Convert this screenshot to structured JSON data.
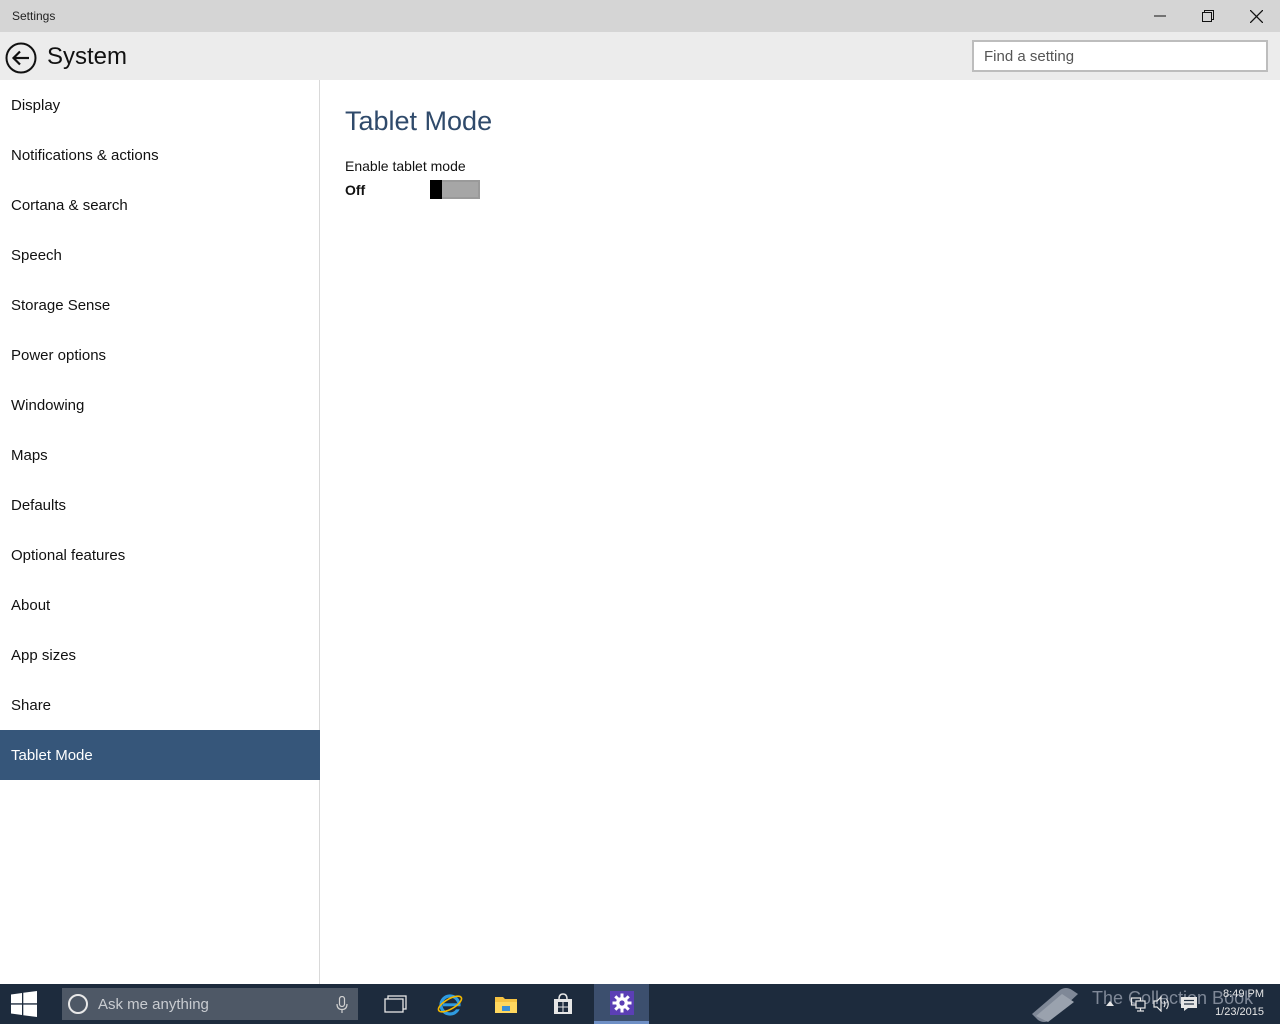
{
  "window": {
    "app_title": "Settings"
  },
  "header": {
    "title": "System",
    "search_placeholder": "Find a setting"
  },
  "sidebar": {
    "items": [
      {
        "label": "Display",
        "active": false
      },
      {
        "label": "Notifications & actions",
        "active": false
      },
      {
        "label": "Cortana & search",
        "active": false
      },
      {
        "label": "Speech",
        "active": false
      },
      {
        "label": "Storage Sense",
        "active": false
      },
      {
        "label": "Power options",
        "active": false
      },
      {
        "label": "Windowing",
        "active": false
      },
      {
        "label": "Maps",
        "active": false
      },
      {
        "label": "Defaults",
        "active": false
      },
      {
        "label": "Optional features",
        "active": false
      },
      {
        "label": "About",
        "active": false
      },
      {
        "label": "App sizes",
        "active": false
      },
      {
        "label": "Share",
        "active": false
      },
      {
        "label": "Tablet Mode",
        "active": true
      }
    ]
  },
  "content": {
    "title": "Tablet Mode",
    "setting_label": "Enable tablet mode",
    "toggle_state": "Off"
  },
  "taskbar": {
    "search_placeholder": "Ask me anything",
    "pinned_icons": [
      "task-view-icon",
      "internet-explorer-icon",
      "file-explorer-icon",
      "store-icon",
      "settings-icon"
    ],
    "watermark": "The Collection Book",
    "clock_time": "8:49 PM",
    "clock_date": "1/23/2015"
  },
  "colors": {
    "accent": "#36567a",
    "title_text": "#2f4a6b",
    "taskbar": "#1d2b3d",
    "titlebar": "#d5d5d5",
    "header": "#ececec"
  }
}
